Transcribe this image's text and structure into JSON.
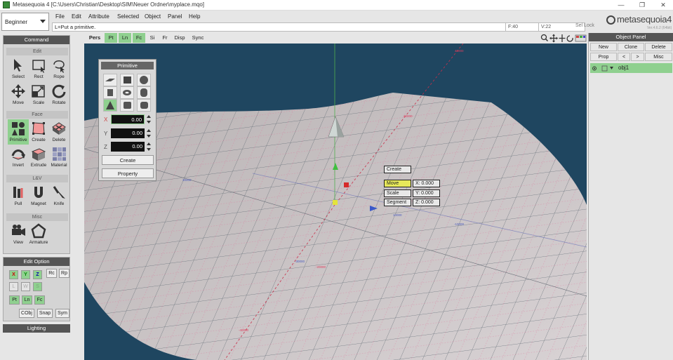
{
  "window": {
    "title": "Metasequoia 4 [C:\\Users\\Christian\\Desktop\\SIM\\Neuer Ordner\\myplace.mqo]",
    "controls": [
      "—",
      "❐",
      "✕"
    ]
  },
  "mode": {
    "selected": "Beginner"
  },
  "menu": [
    "File",
    "Edit",
    "Attribute",
    "Selected",
    "Object",
    "Panel",
    "Help"
  ],
  "status": {
    "message": "L=Put a primitive.",
    "face_count": "F:40",
    "vertex_count": "V:22",
    "sel_lock": "Sel Lock"
  },
  "logo": {
    "text": "metasequoia4",
    "version": "Ver.4.6.2 (64bit)"
  },
  "command_panel": {
    "title": "Command",
    "sections": {
      "edit": "Edit",
      "face": "Face",
      "lv": "L&V",
      "misc": "Misc"
    },
    "edit_tools": [
      "Select",
      "Rect",
      "Rope",
      "Move",
      "Scale",
      "Rotate"
    ],
    "face_tools": [
      "Primitive",
      "Create",
      "Delete",
      "Invert",
      "Extrude",
      "Material"
    ],
    "lv_tools": [
      "Pull",
      "Magnet",
      "Knife"
    ],
    "misc_tools": [
      "View",
      "Armature"
    ]
  },
  "edit_option": {
    "title": "Edit Option",
    "axes": [
      "X",
      "Y",
      "Z"
    ],
    "row1_extra": [
      "Rc",
      "Rp"
    ],
    "space": [
      "L",
      "W",
      "S"
    ],
    "elements": [
      "Pt",
      "Ln",
      "Fc"
    ],
    "bottom": [
      "CObj",
      "Snap",
      "Sym"
    ]
  },
  "lighting": "Lighting",
  "view_toolbar": {
    "projection": "Pers",
    "tabs": [
      "Pt",
      "Ln",
      "Fc",
      "Si",
      "Fr",
      "Disp",
      "Sync"
    ],
    "active_tabs": [
      "Pt",
      "Ln",
      "Fc"
    ]
  },
  "primitive_panel": {
    "title": "Primitive",
    "x_label": "X",
    "y_label": "Y",
    "z_label": "Z",
    "x": "0.00",
    "y": "0.00",
    "z": "0.00",
    "create": "Create",
    "property": "Property"
  },
  "gizmo_menu": {
    "create": "Create",
    "move": "Move",
    "scale": "Scale",
    "segment": "Segment",
    "x": "X: 0.000",
    "y": "Y: 0.000",
    "z": "Z: 0.000"
  },
  "grid_labels": [
    "40000",
    "30000",
    "20000",
    "10000",
    "-10000",
    "-20000",
    "-30000",
    "-40000"
  ],
  "object_panel": {
    "title": "Object Panel",
    "buttons": [
      "New",
      "Clone",
      "Delete"
    ],
    "row2": [
      "Prop",
      "<",
      ">",
      "Misc"
    ],
    "objects": [
      {
        "name": "obj1"
      }
    ]
  },
  "colors": {
    "accent": "#8fd08f",
    "viewport": "#1f4660",
    "highlight": "#e7e85a"
  }
}
